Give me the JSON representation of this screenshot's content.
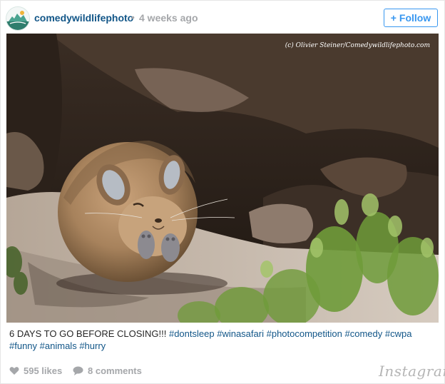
{
  "header": {
    "username": "comedywildlifephoto",
    "separator": "•",
    "time": "4 weeks ago",
    "follow_label": "Follow",
    "follow_prefix": "+"
  },
  "photo": {
    "watermark": "(c) Olivier Steiner/Comedywildlifephoto.com",
    "subject": "pika-photo"
  },
  "caption": {
    "text": "6 DAYS TO GO BEFORE CLOSING!!!",
    "hashtags": [
      "#dontsleep",
      "#winasafari",
      "#photocompetition",
      "#comedy",
      "#cwpa",
      "#funny",
      "#animals",
      "#hurry"
    ]
  },
  "footer": {
    "likes": "595 likes",
    "comments": "8 comments",
    "brand": "Instagram"
  },
  "colors": {
    "link": "#125688",
    "follow_blue": "#3897f0",
    "muted": "#a5a7aa"
  }
}
